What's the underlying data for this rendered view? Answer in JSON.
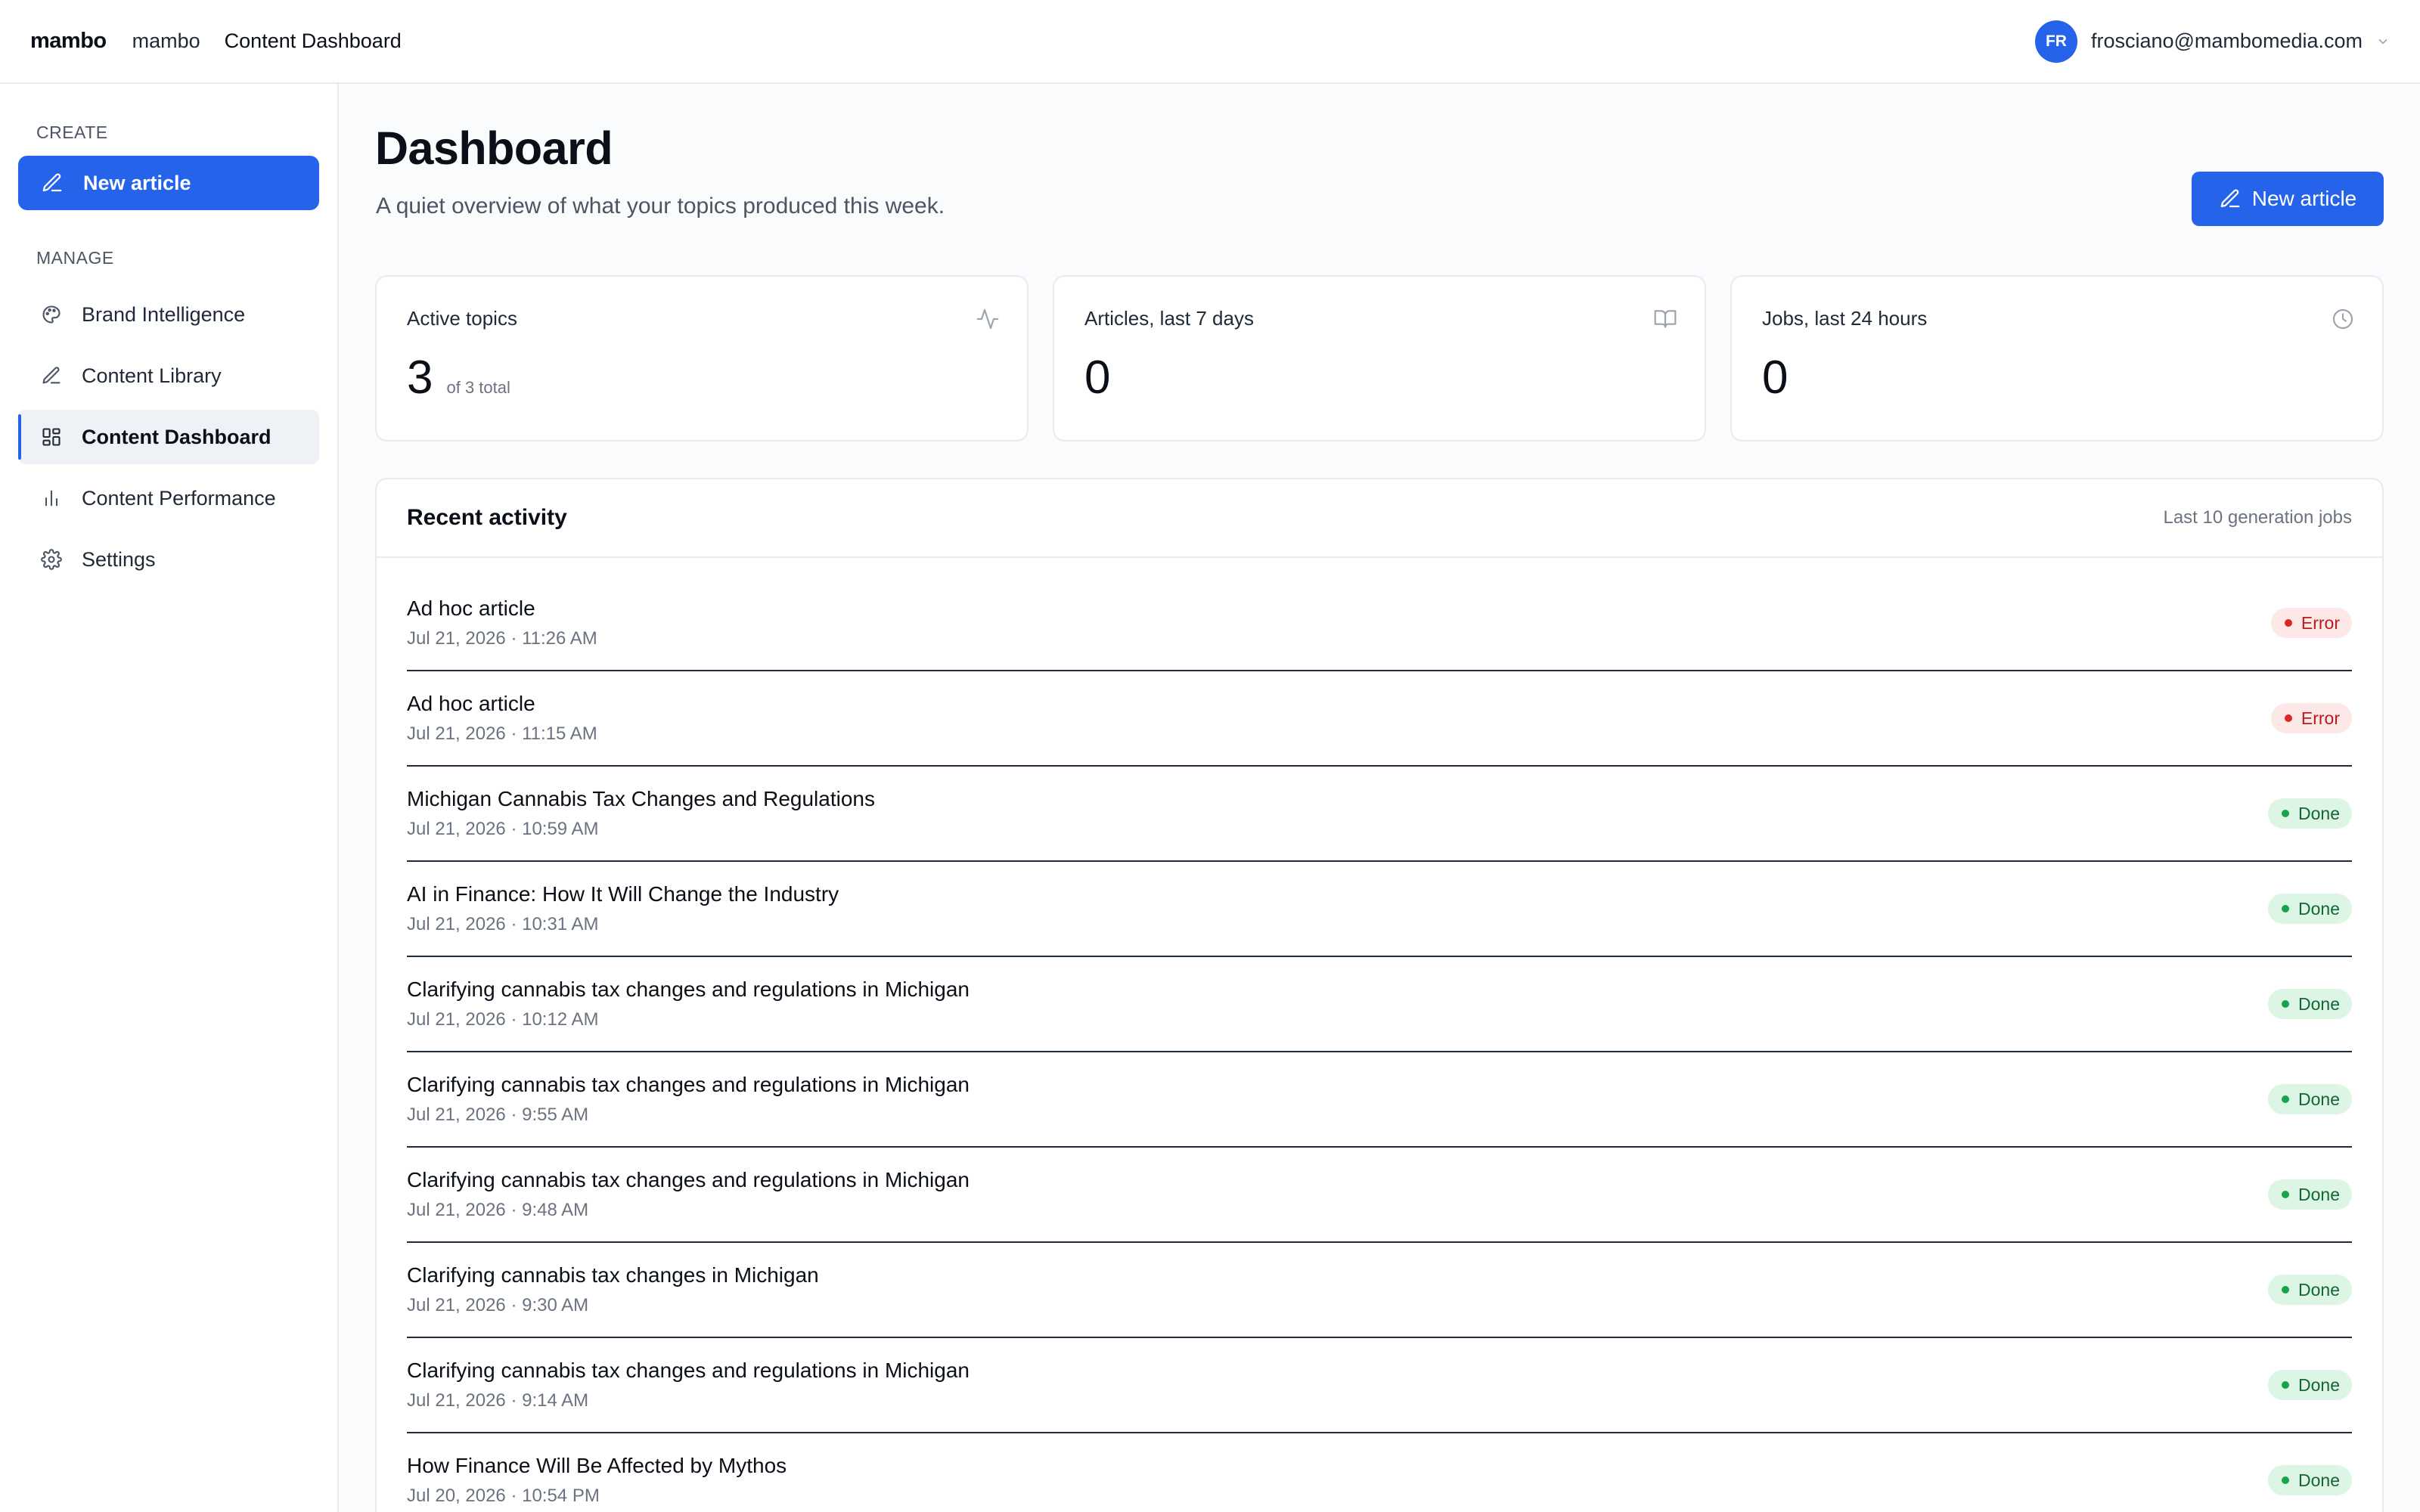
{
  "topbar": {
    "logo": "mambo",
    "breadcrumb": [
      "mambo",
      "Content Dashboard"
    ],
    "user_initials": "FR",
    "user_email": "frosciano@mambomedia.com"
  },
  "sidebar": {
    "create_label": "CREATE",
    "new_article_label": "New article",
    "manage_label": "MANAGE",
    "items": [
      {
        "label": "Brand Intelligence",
        "icon": "palette-icon"
      },
      {
        "label": "Content Library",
        "icon": "pencil-icon"
      },
      {
        "label": "Content Dashboard",
        "icon": "dashboard-grid-icon",
        "active": true
      },
      {
        "label": "Content Performance",
        "icon": "bar-chart-icon"
      },
      {
        "label": "Settings",
        "icon": "gear-icon"
      }
    ]
  },
  "main": {
    "title": "Dashboard",
    "subtitle": "A quiet overview of what your topics produced this week.",
    "new_article_label": "New article",
    "stats": [
      {
        "label": "Active topics",
        "value": "3",
        "sub": "of 3 total",
        "icon": "activity-icon"
      },
      {
        "label": "Articles, last 7 days",
        "value": "0",
        "sub": "",
        "icon": "book-open-icon"
      },
      {
        "label": "Jobs, last 24 hours",
        "value": "0",
        "sub": "",
        "icon": "clock-icon"
      }
    ],
    "activity": {
      "title": "Recent activity",
      "meta": "Last 10 generation jobs",
      "rows": [
        {
          "title": "Ad hoc article",
          "date": "Jul 21, 2026 · 11:26 AM",
          "status": "Error"
        },
        {
          "title": "Ad hoc article",
          "date": "Jul 21, 2026 · 11:15 AM",
          "status": "Error"
        },
        {
          "title": "Michigan Cannabis Tax Changes and Regulations",
          "date": "Jul 21, 2026 · 10:59 AM",
          "status": "Done"
        },
        {
          "title": "AI in Finance: How It Will Change the Industry",
          "date": "Jul 21, 2026 · 10:31 AM",
          "status": "Done"
        },
        {
          "title": "Clarifying cannabis tax changes and regulations in Michigan",
          "date": "Jul 21, 2026 · 10:12 AM",
          "status": "Done"
        },
        {
          "title": "Clarifying cannabis tax changes and regulations in Michigan",
          "date": "Jul 21, 2026 · 9:55 AM",
          "status": "Done"
        },
        {
          "title": "Clarifying cannabis tax changes and regulations in Michigan",
          "date": "Jul 21, 2026 · 9:48 AM",
          "status": "Done"
        },
        {
          "title": "Clarifying cannabis tax changes in Michigan",
          "date": "Jul 21, 2026 · 9:30 AM",
          "status": "Done"
        },
        {
          "title": "Clarifying cannabis tax changes and regulations in Michigan",
          "date": "Jul 21, 2026 · 9:14 AM",
          "status": "Done"
        },
        {
          "title": "How Finance Will Be Affected by Mythos",
          "date": "Jul 20, 2026 · 10:54 PM",
          "status": "Done"
        }
      ]
    }
  },
  "colors": {
    "accent": "#2563eb",
    "error_bg": "#fde8e8",
    "error_text": "#b91c1c",
    "done_bg": "#dcf5e4",
    "done_text": "#166534"
  }
}
